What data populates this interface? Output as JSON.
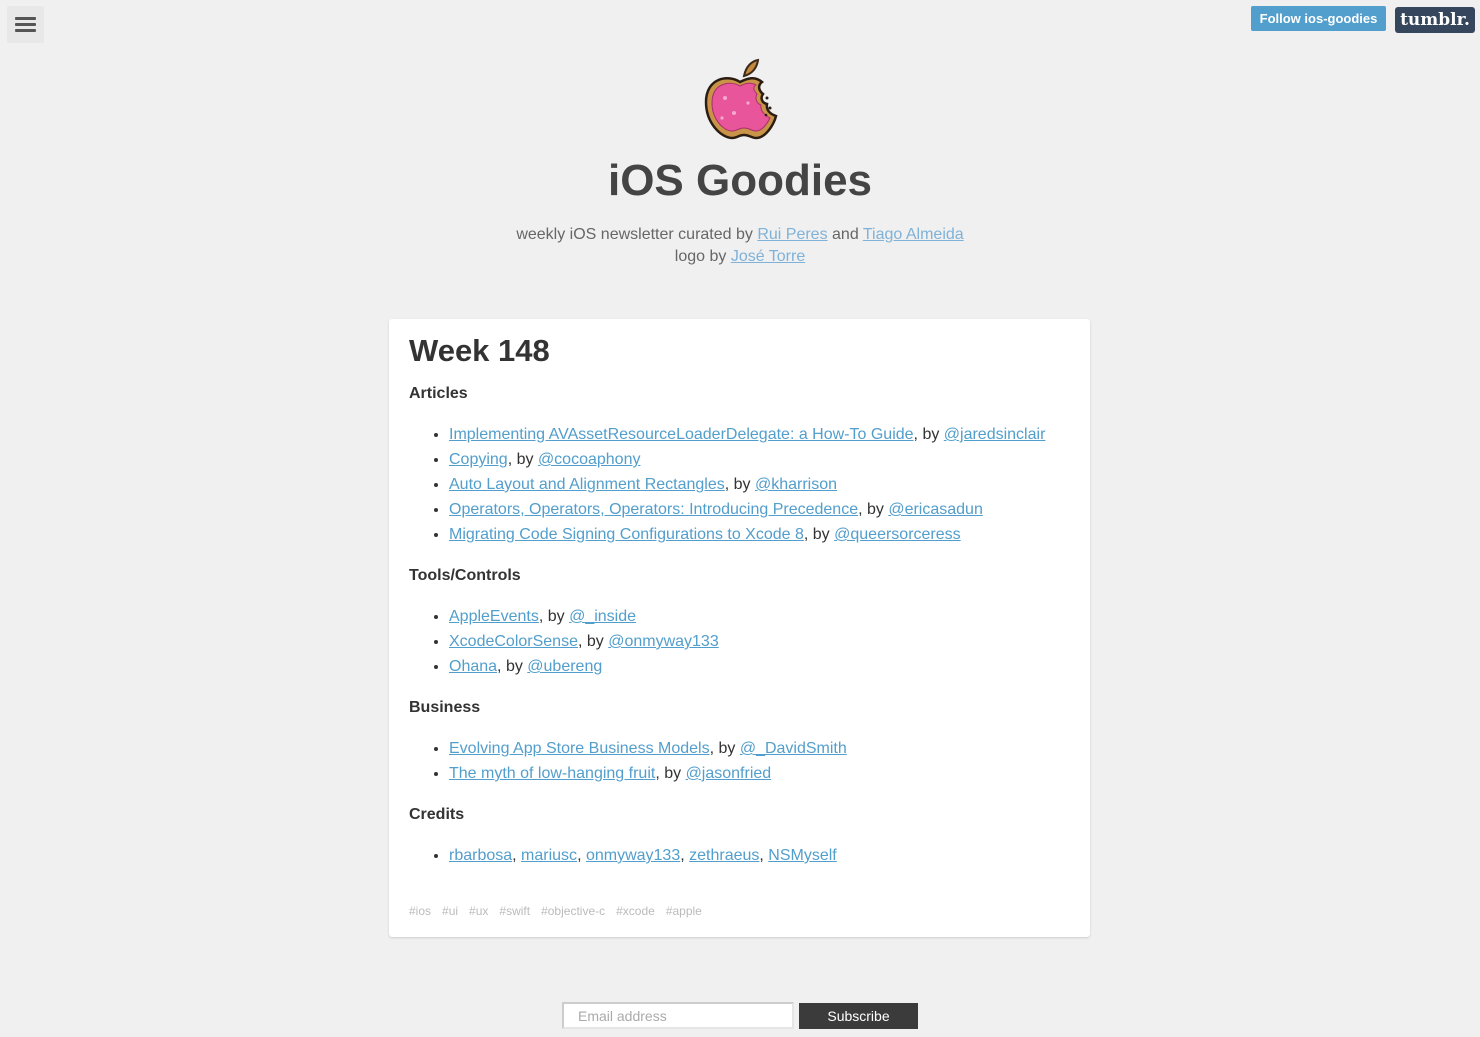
{
  "header": {
    "follow_label": "Follow ios-goodies",
    "tumblr_label": "tumblr."
  },
  "blog": {
    "title": "iOS Goodies",
    "desc_prefix": "weekly iOS newsletter curated by ",
    "curator1": "Rui Peres",
    "desc_and": " and ",
    "curator2": "Tiago Almeida",
    "logo_prefix": "logo by ",
    "logo_author": "José Torre"
  },
  "post": {
    "title": "Week 148",
    "sections": [
      {
        "heading": "Articles",
        "items": [
          {
            "title": "Implementing AVAssetResourceLoaderDelegate: a How-To Guide",
            "by": ", by ",
            "author": "@jaredsinclair"
          },
          {
            "title": "Copying",
            "by": ", by ",
            "author": "@cocoaphony"
          },
          {
            "title": "Auto Layout and Alignment Rectangles",
            "by": ", by ",
            "author": "@kharrison"
          },
          {
            "title": "Operators, Operators, Operators: Introducing Precedence",
            "by": ", by ",
            "author": "@ericasadun"
          },
          {
            "title": "Migrating Code Signing Configurations to Xcode 8",
            "by": ", by ",
            "author": "@queersorceress"
          }
        ]
      },
      {
        "heading": "Tools/Controls",
        "items": [
          {
            "title": "AppleEvents",
            "by": ", by ",
            "author": "@_inside"
          },
          {
            "title": "XcodeColorSense",
            "by": ", by ",
            "author": "@onmyway133"
          },
          {
            "title": "Ohana",
            "by": ", by ",
            "author": "@ubereng"
          }
        ]
      },
      {
        "heading": "Business",
        "items": [
          {
            "title": "Evolving App Store Business Models",
            "by": ", by ",
            "author": "@_DavidSmith"
          },
          {
            "title": "The myth of low-hanging fruit",
            "by": ", by ",
            "author": "@jasonfried"
          }
        ]
      },
      {
        "heading": "Credits",
        "credits": [
          "rbarbosa",
          "mariusc",
          "onmyway133",
          "zethraeus",
          "NSMyself"
        ],
        "separator": ", "
      }
    ],
    "tags": [
      "#ios",
      "#ui",
      "#ux",
      "#swift",
      "#objective-c",
      "#xcode",
      "#apple"
    ]
  },
  "subscribe": {
    "placeholder": "Email address",
    "button_label": "Subscribe"
  },
  "colors": {
    "background": "#f0f0f0",
    "link": "#529ecc",
    "follow_button": "#529ecc",
    "tumblr_button": "#36465d",
    "subscribe_button": "#3b3b3b"
  },
  "icons": {
    "menu": "hamburger-menu-icon",
    "logo": "donut-apple-logo"
  }
}
